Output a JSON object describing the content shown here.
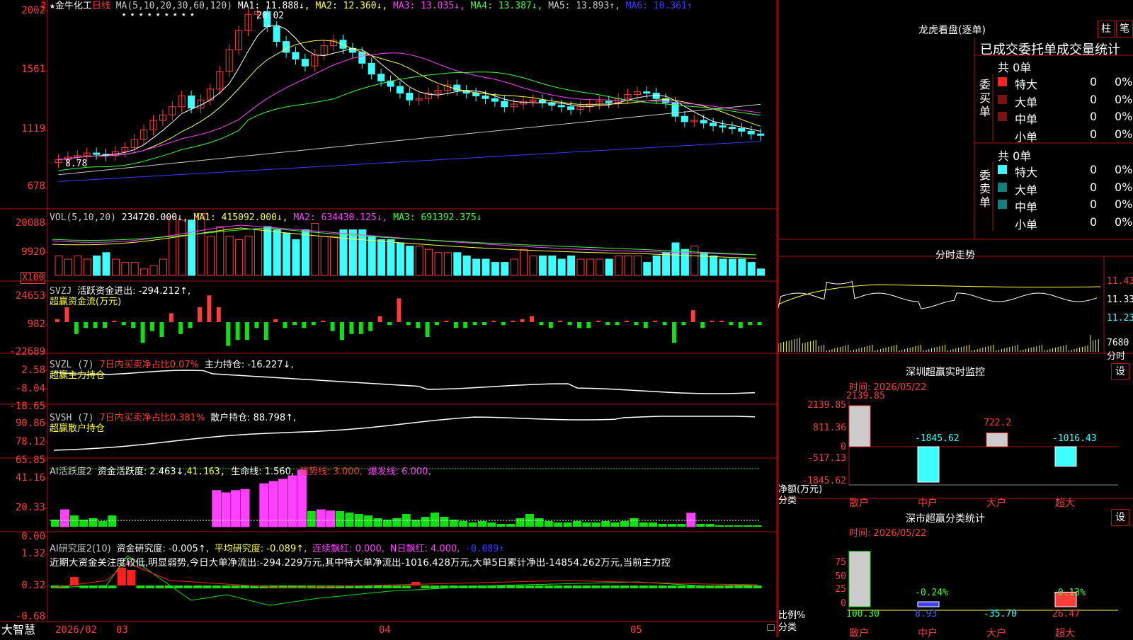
{
  "colors": {
    "bg": "#000000",
    "grid": "#b01010",
    "up": "#ff3c3c",
    "down": "#3cffff",
    "ma1": "#ffffff",
    "ma2": "#ffff3c",
    "ma3": "#ff40ff",
    "ma4": "#3cff3c",
    "ma5": "#c8c8c8",
    "ma6": "#3c3cff"
  },
  "icons": {
    "star": "star-icon",
    "lock": "lock-icon",
    "up_arrow": "up-arrow-icon",
    "down_arrow": "down-arrow-icon"
  },
  "main": {
    "star": "★",
    "stock_name": "金牛化工",
    "period": "日线",
    "ma_params": "MA(5,10,20,30,60,120)",
    "ma1": "MA1: 11.888↓,",
    "ma2": "MA2: 12.360↓,",
    "ma3": "MA3: 13.035↓,",
    "ma4": "MA4: 13.387↓,",
    "ma5": "MA5: 13.893↑,",
    "ma6": "MA6: 10.361↑",
    "high_label": "20.02",
    "low_label": "8.78",
    "marker": "2",
    "yticks": [
      "2002",
      "1561",
      "1119",
      "678"
    ],
    "stars": "★ ★ ★ ★ ★    ★ ★ ★ ★"
  },
  "vol": {
    "title": "VOL(5,10,20)",
    "value": "234720.000↓,",
    "ma1": "MA1: 415092.000↓,",
    "ma2": "MA2: 634430.125↓,",
    "ma3": "MA3: 691392.375↓",
    "yticks": [
      "20088",
      "9920"
    ],
    "unit": "X100"
  },
  "svzj": {
    "title": "SVZJ",
    "desc": "活跃资金进出: -294.212↑,",
    "sub": "超赢资金流(万元)",
    "yticks": [
      "24653",
      "982",
      "-22689"
    ],
    "values": [
      1,
      5,
      -4,
      -2,
      -2,
      -2,
      0,
      -1,
      -2,
      -7,
      -3,
      -5,
      3,
      -4,
      -2,
      5,
      9,
      5,
      -8,
      -6,
      -6,
      -2,
      -6,
      1,
      -2,
      -1,
      -2,
      -1,
      0,
      -3,
      -6,
      -4,
      -4,
      -3,
      2,
      -1,
      8,
      -1,
      -2,
      -5,
      -1,
      0,
      -2,
      -2,
      -1,
      -1,
      0,
      -1,
      0,
      1,
      2,
      -1,
      -2,
      0,
      -1,
      -2,
      -2,
      0,
      -1,
      -1,
      0,
      -1,
      -2,
      0,
      -1,
      -7,
      -1,
      4,
      -2,
      0,
      0,
      -1,
      -2,
      -1,
      -1
    ]
  },
  "svzl": {
    "title": "SVZL (7)",
    "desc_red": "7日内买卖净占比0.07%",
    "desc": "主力持仓: -16.227↓,",
    "sub": "超赢主力持仓",
    "yticks": [
      "2.58",
      "-8.04",
      "-18.65"
    ]
  },
  "svsh": {
    "title": "SVSH (7)",
    "desc_red": "7日内买卖净占比0.381%",
    "desc": "散户持仓: 88.798↑,",
    "sub": "超赢散户持仓",
    "yticks": [
      "90.86",
      "78.12",
      "65.85"
    ]
  },
  "ai1": {
    "title": "AI活跃度2",
    "desc": "资金活跃度: 2.463↓,",
    "v2": "41.163,",
    "v3": "生命线: 1.560,",
    "v4": "强势线: 3.000,",
    "v5": "爆发线: 6.000,",
    "yticks": [
      "41.16",
      "20.33",
      "0.00"
    ]
  },
  "ai2": {
    "title": "AI研究度2(10)",
    "desc": "资金研究度: -0.005↑,",
    "v2": "平均研究度: -0.089↑,",
    "v3": "连续飘红: 0.000,",
    "v4": "N日飘红: 4.000,",
    "v5": "-0.089↑",
    "text": "近期大资金关注度较低,明显弱势,今日大单净流出:-294.229万元,其中特大单净流出-1016.428万元,大单5日累计净出-14854.262万元,当前主力控",
    "yticks": [
      "1.32",
      "0.32",
      "-0.68"
    ]
  },
  "xaxis": {
    "app": "大智慧",
    "labels": [
      "2026/02",
      "03",
      "04",
      "05"
    ]
  },
  "lhb": {
    "title": "龙虎看盘(逐单)",
    "btn1": "柱",
    "btn2": "笔",
    "header": "已成交委托单成交量统计",
    "buy": {
      "side": "委买单",
      "total": "共 0单",
      "rows": [
        {
          "name": "特大",
          "v": "0",
          "p": "0%"
        },
        {
          "name": "大单",
          "v": "0",
          "p": "0%"
        },
        {
          "name": "中单",
          "v": "0",
          "p": "0%"
        },
        {
          "name": "小单",
          "v": "0",
          "p": "0%"
        }
      ]
    },
    "sell": {
      "side": "委卖单",
      "total": "共 0单",
      "rows": [
        {
          "name": "特大",
          "v": "0",
          "p": "0%"
        },
        {
          "name": "大单",
          "v": "0",
          "p": "0%"
        },
        {
          "name": "中单",
          "v": "0",
          "p": "0%"
        },
        {
          "name": "小单",
          "v": "0",
          "p": "0%"
        }
      ]
    }
  },
  "intraday": {
    "title": "分时走势",
    "yticks": [
      "11.43",
      "11.33",
      "11.23"
    ],
    "vol_label": "7680",
    "vol_unit": "分时"
  },
  "szmon": {
    "title": "深圳超赢实时监控",
    "btn": "设",
    "time": "时间: 2026/05/22",
    "yticks": [
      "2139.85",
      "811.36",
      "0",
      "-517.13",
      "-1845.62"
    ],
    "ylabel": "净额(万元)",
    "xlabel": "分类",
    "bars": [
      {
        "cat": "散户",
        "value": 2139.85,
        "label": "2139.85"
      },
      {
        "cat": "中户",
        "value": -1845.62,
        "label": "-1845.62"
      },
      {
        "cat": "大户",
        "value": 722.2,
        "label": "722.2"
      },
      {
        "cat": "超大",
        "value": -1016.43,
        "label": "-1016.43"
      }
    ]
  },
  "szcls": {
    "title": "深市超赢分类统计",
    "btn": "设",
    "time": "时间: 2026/05/22",
    "yticks": [
      "75",
      "50",
      "25",
      "0"
    ],
    "ylabel": "比例%",
    "xlabel": "分类",
    "bars": [
      {
        "cat": "散户",
        "value": 100.3,
        "label": "100.30",
        "pct": ""
      },
      {
        "cat": "中户",
        "value": 8.93,
        "label": "8.93",
        "pct": "-0.24%"
      },
      {
        "cat": "大户",
        "value": -35.7,
        "label": "-35.70",
        "pct": ""
      },
      {
        "cat": "超大",
        "value": 26.47,
        "label": "26.47",
        "pct": "-0.13%"
      }
    ]
  }
}
